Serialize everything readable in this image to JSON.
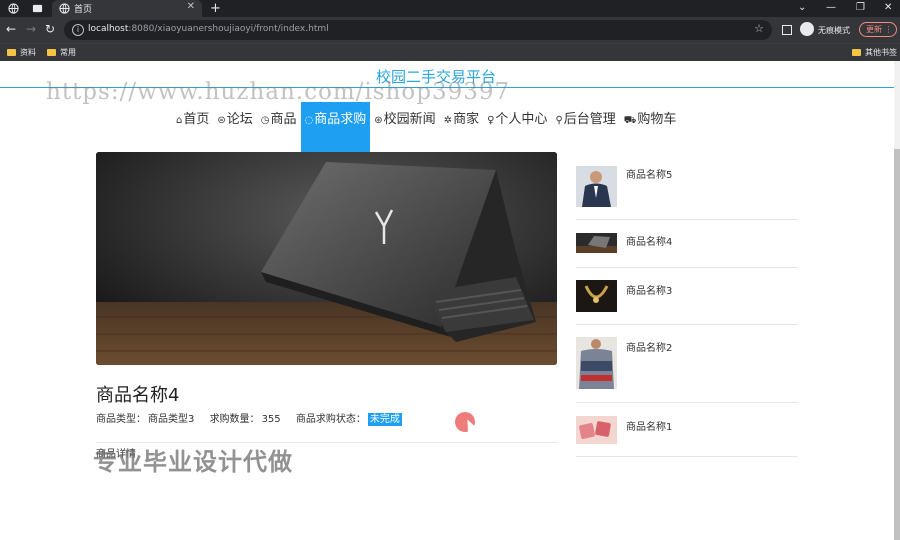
{
  "browser": {
    "tab_title": "首页",
    "url_host": "localhost",
    "url_rest": ":8080/xiaoyuanershoujiaoyi/front/index.html",
    "incognito_label": "无痕模式",
    "update_label": "更新",
    "bookmarks": [
      "资料",
      "常用"
    ],
    "other_bookmarks": "其他书签"
  },
  "site": {
    "title": "校园二手交易平台",
    "watermark": "https://www.huzhan.com/ishop39397",
    "watermark2": "专业毕业设计代做"
  },
  "nav": {
    "items": [
      {
        "icon": "⌂",
        "label": "首页"
      },
      {
        "icon": "⊜",
        "label": "论坛"
      },
      {
        "icon": "◷",
        "label": "商品"
      },
      {
        "icon": "◌",
        "label": "商品求购"
      },
      {
        "icon": "⊛",
        "label": "校园新闻"
      },
      {
        "icon": "✲",
        "label": "商家"
      },
      {
        "icon": "♀",
        "label": "个人中心"
      },
      {
        "icon": "⚲",
        "label": "后台管理"
      },
      {
        "icon": "⛟",
        "label": "购物车"
      }
    ],
    "active_index": 3
  },
  "product": {
    "name": "商品名称4",
    "type_label": "商品类型：",
    "type_value": "商品类型3",
    "qty_label": "求购数量：",
    "qty_value": "355",
    "status_label": "商品求购状态：",
    "status_value": "未完成",
    "detail_label": "商品详情"
  },
  "sidebar": {
    "items": [
      {
        "name": "商品名称5"
      },
      {
        "name": "商品名称4"
      },
      {
        "name": "商品名称3"
      },
      {
        "name": "商品名称2"
      },
      {
        "name": "商品名称1"
      }
    ]
  },
  "colors": {
    "accent": "#1e9ff2",
    "title": "#29a5df",
    "status_bg": "#1e9ff2"
  }
}
